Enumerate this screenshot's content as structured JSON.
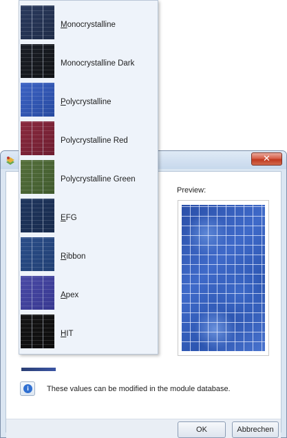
{
  "dialog": {
    "close_label": "✕",
    "preview_label": "Preview:",
    "info_text": "These values can be modified in the module database.",
    "ok_label": "OK",
    "cancel_label": "Abbrechen"
  },
  "dropdown": {
    "items": [
      {
        "label_u": "M",
        "label_rest": "onocrystalline",
        "colors": [
          "#2a3a5e",
          "#1f2c48"
        ]
      },
      {
        "label_u": "",
        "label_rest": "Monocrystalline Dark",
        "colors": [
          "#1b1f27",
          "#121417"
        ]
      },
      {
        "label_u": "P",
        "label_rest": "olycrystalline",
        "colors": [
          "#3d63c4",
          "#274aa0"
        ]
      },
      {
        "label_u": "",
        "label_rest": "Polycrystalline Red",
        "colors": [
          "#8a2a3e",
          "#6e1d30"
        ]
      },
      {
        "label_u": "",
        "label_rest": "Polycrystalline Green",
        "colors": [
          "#56703c",
          "#3f5a2d"
        ]
      },
      {
        "label_u": "E",
        "label_rest": "FG",
        "colors": [
          "#203760",
          "#172a4c"
        ]
      },
      {
        "label_u": "R",
        "label_rest": "ibbon",
        "colors": [
          "#2b4e8a",
          "#203f73"
        ]
      },
      {
        "label_u": "A",
        "label_rest": "pex",
        "colors": [
          "#4a4aa6",
          "#373890"
        ]
      },
      {
        "label_u": "H",
        "label_rest": "IT",
        "colors": [
          "#151515",
          "#0c0c0c"
        ]
      }
    ]
  }
}
